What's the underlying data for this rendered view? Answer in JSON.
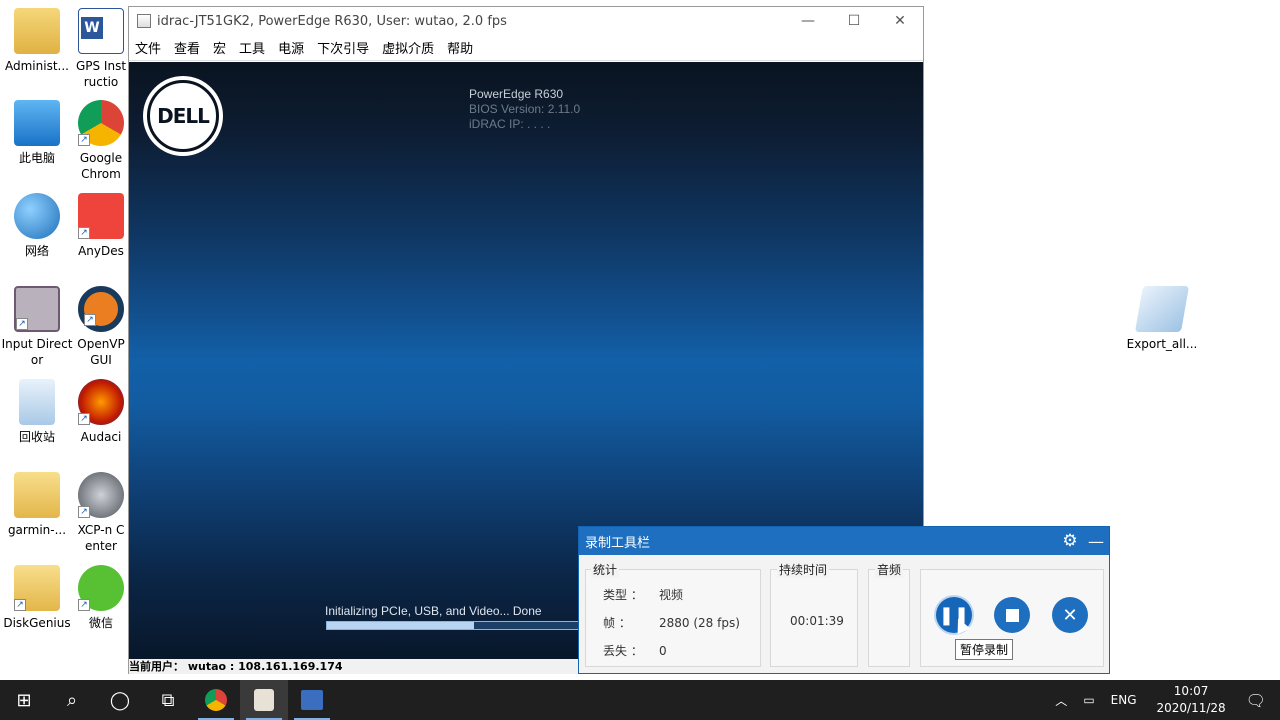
{
  "desktop": {
    "left_icons": [
      {
        "name": "administrator-folder",
        "label": "Administ..."
      },
      {
        "name": "this-pc",
        "label": "此电脑"
      },
      {
        "name": "network",
        "label": "网络"
      },
      {
        "name": "input-director",
        "label": "Input Director"
      },
      {
        "name": "recycle-bin",
        "label": "回收站"
      },
      {
        "name": "garmin-folder",
        "label": "garmin-..."
      },
      {
        "name": "diskgenius",
        "label": "DiskGenius"
      }
    ],
    "second_icons": [
      {
        "name": "gps-instructions",
        "label": "GPS Instructio"
      },
      {
        "name": "google-chrome",
        "label": "Google Chrom"
      },
      {
        "name": "anydesk",
        "label": "AnyDes"
      },
      {
        "name": "openvpn-gui",
        "label": "OpenVP GUI"
      },
      {
        "name": "audacity",
        "label": "Audaci"
      },
      {
        "name": "xcp-center",
        "label": "XCP-n Center"
      },
      {
        "name": "wechat",
        "label": "微信"
      }
    ],
    "right_icon": {
      "name": "export-all-file",
      "label": "Export_all..."
    }
  },
  "idrac": {
    "title": "idrac-JT51GK2, PowerEdge R630, User: wutao, 2.0 fps",
    "menu": [
      "文件",
      "查看",
      "宏",
      "工具",
      "电源",
      "下次引导",
      "虚拟介质",
      "帮助"
    ],
    "screen": {
      "logo": "DELL",
      "model": "PowerEdge R630",
      "bios": "BIOS Version: 2.11.0",
      "ip": "iDRAC IP: . . . .",
      "init": "Initializing PCIe, USB, and Video... Done",
      "progress": 0.57
    },
    "status": "当前用户：  wutao : 108.161.169.174"
  },
  "recorder": {
    "title": "录制工具栏",
    "stats_title": "统计",
    "duration_title": "持续时间",
    "audio_title": "音频",
    "type_k": "类型 ：",
    "type_v": "视频",
    "frames_k": "帧     ：",
    "frames_v": "2880 (28 fps)",
    "lost_k": "丢失 ：",
    "lost_v": "0",
    "duration": "00:01:39",
    "tooltip": "暂停录制"
  },
  "taskbar": {
    "lang": "ENG",
    "time": "10:07",
    "date": "2020/11/28"
  }
}
